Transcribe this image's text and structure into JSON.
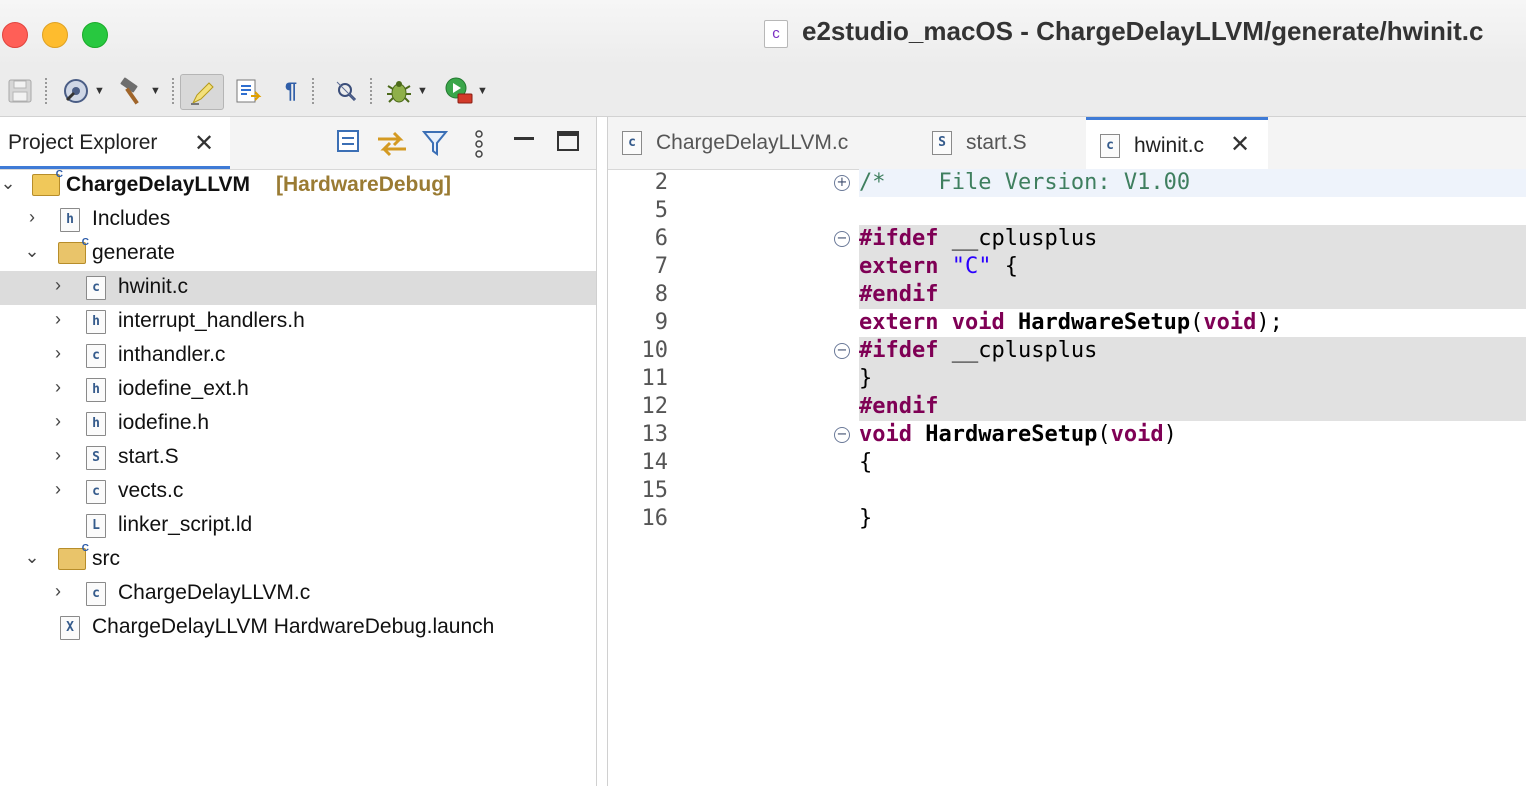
{
  "window": {
    "title": "e2studio_macOS - ChargeDelayLLVM/generate/hwinit.c",
    "doc_icon": "c"
  },
  "toolbar": {
    "icons": [
      "save-icon",
      "build-config-icon",
      "hammer-icon",
      "highlight-icon",
      "bookmark-icon",
      "pilcrow-icon",
      "search-icon",
      "debug-bug-icon",
      "run-icon"
    ]
  },
  "explorer": {
    "tab_label": "Project Explorer",
    "project": {
      "name": "ChargeDelayLLVM",
      "config": "[HardwareDebug]"
    },
    "items": [
      {
        "label": "Includes",
        "icon": "h",
        "indent": 1,
        "twisty": "›",
        "kind": "includes"
      },
      {
        "label": "generate",
        "indent": 1,
        "twisty": "⌄",
        "kind": "folder"
      },
      {
        "label": "hwinit.c",
        "icon": "c",
        "indent": 2,
        "twisty": "›",
        "kind": "file",
        "selected": true
      },
      {
        "label": "interrupt_handlers.h",
        "icon": "h",
        "indent": 2,
        "twisty": "›",
        "kind": "file"
      },
      {
        "label": "inthandler.c",
        "icon": "c",
        "indent": 2,
        "twisty": "›",
        "kind": "file"
      },
      {
        "label": "iodefine_ext.h",
        "icon": "h",
        "indent": 2,
        "twisty": "›",
        "kind": "file"
      },
      {
        "label": "iodefine.h",
        "icon": "h",
        "indent": 2,
        "twisty": "›",
        "kind": "file"
      },
      {
        "label": "start.S",
        "icon": "S",
        "indent": 2,
        "twisty": "›",
        "kind": "file"
      },
      {
        "label": "vects.c",
        "icon": "c",
        "indent": 2,
        "twisty": "›",
        "kind": "file"
      },
      {
        "label": "linker_script.ld",
        "icon": "L",
        "indent": 2,
        "twisty": "",
        "kind": "file"
      },
      {
        "label": "src",
        "indent": 1,
        "twisty": "⌄",
        "kind": "folder"
      },
      {
        "label": "ChargeDelayLLVM.c",
        "icon": "c",
        "indent": 2,
        "twisty": "›",
        "kind": "file"
      },
      {
        "label": "ChargeDelayLLVM HardwareDebug.launch",
        "icon": "X",
        "indent": 1,
        "twisty": "",
        "kind": "file"
      }
    ]
  },
  "editor": {
    "tabs": [
      {
        "label": "ChargeDelayLLVM.c",
        "icon": "c",
        "active": false
      },
      {
        "label": "start.S",
        "icon": "S",
        "active": false
      },
      {
        "label": "hwinit.c",
        "icon": "c",
        "active": true
      }
    ],
    "lines": [
      {
        "num": "2",
        "fold": "+",
        "hl": "blue",
        "tokens": [
          {
            "t": "/*    File Version: V1.00",
            "c": "cmt"
          }
        ]
      },
      {
        "num": "5",
        "fold": "",
        "hl": "",
        "tokens": []
      },
      {
        "num": "6",
        "fold": "−",
        "hl": "grey",
        "tokens": [
          {
            "t": "#ifdef",
            "c": "pp"
          },
          {
            "t": " __cplusplus",
            "c": ""
          }
        ]
      },
      {
        "num": "7",
        "fold": "",
        "hl": "grey",
        "tokens": [
          {
            "t": "extern",
            "c": "kw"
          },
          {
            "t": " ",
            "c": ""
          },
          {
            "t": "\"C\"",
            "c": "str"
          },
          {
            "t": " {",
            "c": ""
          }
        ]
      },
      {
        "num": "8",
        "fold": "",
        "hl": "grey",
        "tokens": [
          {
            "t": "#endif",
            "c": "pp"
          }
        ]
      },
      {
        "num": "9",
        "fold": "",
        "hl": "",
        "tokens": [
          {
            "t": "extern",
            "c": "kw"
          },
          {
            "t": " ",
            "c": ""
          },
          {
            "t": "void",
            "c": "kw"
          },
          {
            "t": " ",
            "c": ""
          },
          {
            "t": "HardwareSetup",
            "c": "fn"
          },
          {
            "t": "(",
            "c": ""
          },
          {
            "t": "void",
            "c": "kw"
          },
          {
            "t": ");",
            "c": ""
          }
        ]
      },
      {
        "num": "10",
        "fold": "−",
        "hl": "grey",
        "tokens": [
          {
            "t": "#ifdef",
            "c": "pp"
          },
          {
            "t": " __cplusplus",
            "c": ""
          }
        ]
      },
      {
        "num": "11",
        "fold": "",
        "hl": "grey",
        "tokens": [
          {
            "t": "}",
            "c": ""
          }
        ]
      },
      {
        "num": "12",
        "fold": "",
        "hl": "grey",
        "tokens": [
          {
            "t": "#endif",
            "c": "pp"
          }
        ]
      },
      {
        "num": "13",
        "fold": "−",
        "hl": "",
        "tokens": [
          {
            "t": "void",
            "c": "kw"
          },
          {
            "t": " ",
            "c": ""
          },
          {
            "t": "HardwareSetup",
            "c": "fn"
          },
          {
            "t": "(",
            "c": ""
          },
          {
            "t": "void",
            "c": "kw"
          },
          {
            "t": ")",
            "c": ""
          }
        ]
      },
      {
        "num": "14",
        "fold": "",
        "hl": "",
        "tokens": [
          {
            "t": "{",
            "c": ""
          }
        ]
      },
      {
        "num": "15",
        "fold": "",
        "hl": "",
        "tokens": []
      },
      {
        "num": "16",
        "fold": "",
        "hl": "",
        "tokens": [
          {
            "t": "}",
            "c": ""
          }
        ]
      }
    ]
  },
  "colors": {
    "accent": "#3f7bd6",
    "keyword": "#7f0055",
    "string": "#2a00ff",
    "comment": "#3f7f5f",
    "selected_row": "#dcdcdc",
    "folded_bg": "#e1e1e1"
  }
}
